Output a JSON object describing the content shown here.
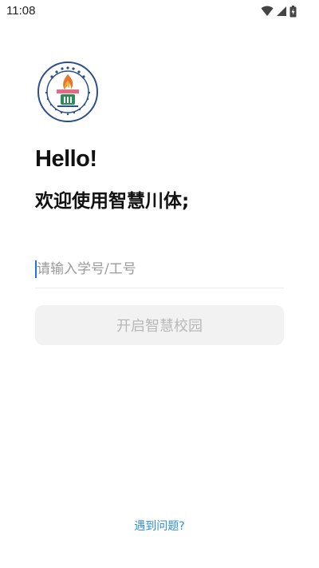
{
  "status_bar": {
    "time": "11:08",
    "icons": [
      "wifi-icon",
      "cell-signal-icon",
      "battery-icon"
    ]
  },
  "logo": {
    "text_top": "四川体育职业学院",
    "text_bottom": "SICHUAN SPORTS COLLEGE",
    "year": "1956",
    "colors": {
      "ring": "#2b4f8f",
      "flame": "#e8772e",
      "emblem_green": "#2e8b57"
    }
  },
  "greeting": {
    "hello": "Hello!",
    "welcome": "欢迎使用智慧川体;"
  },
  "login": {
    "id_placeholder": "请输入学号/工号",
    "id_value": "",
    "submit_label": "开启智慧校园"
  },
  "footer": {
    "help_label": "遇到问题?"
  },
  "colors": {
    "accent_link": "#2e8fd6",
    "caret": "#1a73e8",
    "button_disabled_bg": "#f2f2f2",
    "button_disabled_text": "#b8b8b8"
  }
}
